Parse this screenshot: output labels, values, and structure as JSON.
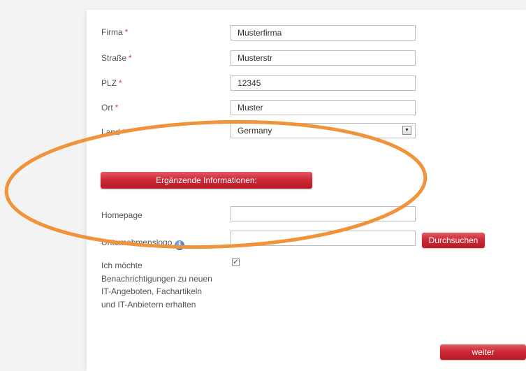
{
  "form": {
    "fields": [
      {
        "label": "Firma",
        "required_mark": "*",
        "value": "Musterfirma"
      },
      {
        "label": "Straße",
        "required_mark": "*",
        "value": "Musterstr"
      },
      {
        "label": "PLZ",
        "required_mark": "*",
        "value": "12345"
      },
      {
        "label": "Ort",
        "required_mark": "*",
        "value": "Muster"
      }
    ],
    "country": {
      "label": "Land",
      "required_mark": "*",
      "value": "Germany",
      "arrow_glyph": "▼"
    },
    "section_button_label": "Ergänzende Informationen:",
    "homepage": {
      "label": "Homepage",
      "value": ""
    },
    "logo": {
      "label": "Unternehmenslogo",
      "info_glyph": "i",
      "value": "",
      "browse_label": "Durchsuchen"
    },
    "consent": {
      "text": "Ich möchte Benachrichtigungen zu neuen IT-Angeboten, Fachartikeln und IT-Anbietern erhalten",
      "checked": true,
      "check_glyph": "✓"
    },
    "next_label": "weiter"
  },
  "colors": {
    "accent_red": "#cc2a36",
    "highlight_orange": "#f0933a",
    "required_red": "#dd3333"
  }
}
